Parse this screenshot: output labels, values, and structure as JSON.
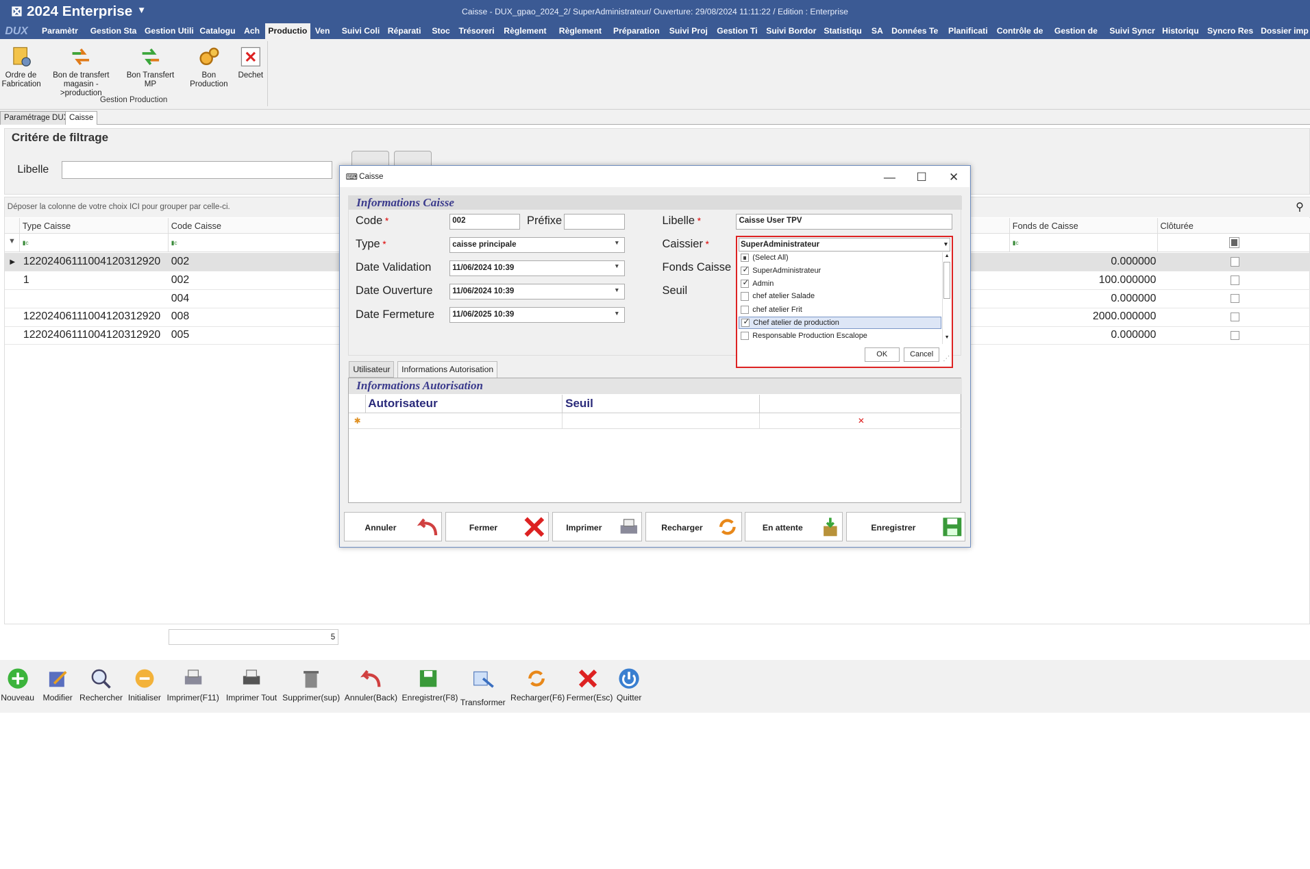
{
  "app": {
    "brand": "⊠ 2024  Enterprise",
    "window_title": "Caisse - DUX_gpao_2024_2/ SuperAdministrateur/ Ouverture: 29/08/2024 11:11:22 / Edition : Enterprise",
    "logo": "DUX"
  },
  "menu": [
    "Paramètr",
    "Gestion Sta",
    "Gestion Utili",
    "Catalogu",
    "Ach",
    "Productio",
    "Ven",
    "Suivi Coli",
    "Réparati",
    "Stoc",
    "Trésoreri",
    "Règlement",
    "Règlement",
    "Préparation",
    "Suivi Proj",
    "Gestion Ti",
    "Suivi Bordor",
    "Statistiqu",
    "SA",
    "Données Te",
    "Planificati",
    "Contrôle de",
    "Gestion de",
    "Suivi Syncr",
    "Historiqu",
    "Syncro Res",
    "Dossier imp"
  ],
  "ribbon": {
    "buttons": [
      "Ordre de\nFabrication",
      "Bon de transfert\nmagasin ->production",
      "Bon Transfert MP",
      "Bon Production",
      "Dechet"
    ],
    "group_label": "Gestion Production"
  },
  "doc_tabs": [
    "Paramétrage DUX",
    "Caisse"
  ],
  "filter": {
    "title": "Critére de filtrage",
    "libelle_label": "Libelle"
  },
  "grid": {
    "group_hint": "Déposer la colonne de votre choix ICI pour grouper par celle-ci.",
    "columns": [
      "Type Caisse",
      "Code Caisse",
      "Fonds de Caisse",
      "Clôturée"
    ],
    "rows": [
      {
        "type": "1220240611100412031292​0",
        "code": "002",
        "fonds": "0.000000"
      },
      {
        "type": "1",
        "code": "002",
        "fonds": "100.000000"
      },
      {
        "type": "",
        "code": "004",
        "fonds": "0.000000"
      },
      {
        "type": "12202406111004120312920",
        "code": "008",
        "fonds": "2000.000000"
      },
      {
        "type": "12202406111004120312920",
        "code": "005",
        "fonds": "0.000000"
      }
    ],
    "count": "5"
  },
  "bottom": [
    "Nouveau",
    "Modifier",
    "Rechercher",
    "Initialiser",
    "Imprimer(F11)",
    "Imprimer Tout",
    "Supprimer(sup)",
    "Annuler(Back)",
    "Enregistrer(F8)",
    "Transformer",
    "Recharger(F6)",
    "Fermer(Esc)",
    "Quitter"
  ],
  "dialog": {
    "title": "Caisse",
    "section": "Informations Caisse",
    "labels": {
      "code": "Code",
      "prefixe": "Préfixe",
      "type": "Type",
      "date_validation": "Date Validation",
      "date_ouverture": "Date Ouverture",
      "date_fermeture": "Date Fermeture",
      "libelle": "Libelle",
      "caissier": "Caissier",
      "fonds": "Fonds Caisse",
      "seuil": "Seuil"
    },
    "values": {
      "code": "002",
      "prefixe": "",
      "type": "caisse principale",
      "date_validation": "11/06/2024 10:39",
      "date_ouverture": "11/06/2024 10:39",
      "date_fermeture": "11/06/2025 10:39",
      "libelle": "Caisse User TPV",
      "caissier": "SuperAdministrateur"
    },
    "tabs": [
      "Utilisateur",
      "Informations Autorisation"
    ],
    "auth_section": "Informations Autorisation",
    "auth_cols": [
      "Autorisateur",
      "Seuil"
    ],
    "buttons": [
      "Annuler",
      "Fermer",
      "Imprimer",
      "Recharger",
      "En attente",
      "Enregistrer"
    ],
    "dropdown": {
      "items": [
        {
          "label": "(Select All)",
          "state": "partial"
        },
        {
          "label": "SuperAdministrateur",
          "state": "checked"
        },
        {
          "label": "Admin",
          "state": "checked"
        },
        {
          "label": "chef atelier Salade",
          "state": "unchecked"
        },
        {
          "label": "chef atelier Frit",
          "state": "unchecked"
        },
        {
          "label": "Chef atelier de production",
          "state": "checked"
        },
        {
          "label": "Responsable Production Escalope",
          "state": "unchecked"
        }
      ],
      "ok": "OK",
      "cancel": "Cancel"
    }
  },
  "colors": {
    "title_bar": "#3b5a94",
    "accent_red": "#d22222",
    "section_text": "#3a3a8c"
  }
}
